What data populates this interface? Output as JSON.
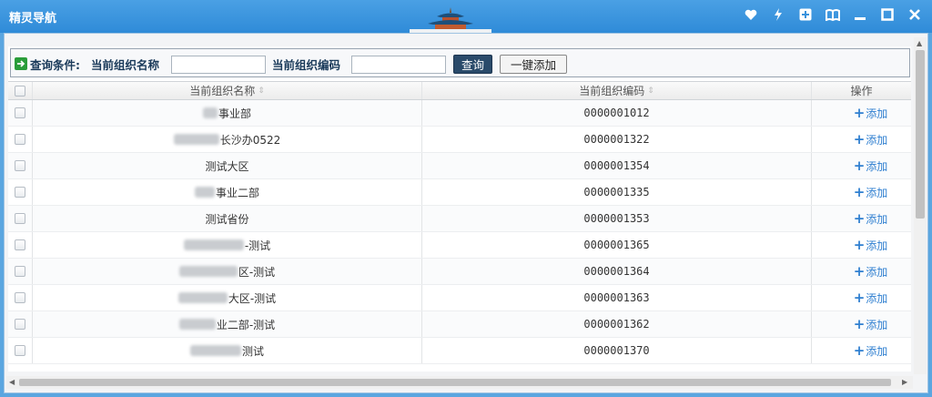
{
  "window": {
    "title": "精灵导航"
  },
  "toolbar": {
    "query_label": "查询条件:",
    "name_label": "当前组织名称",
    "name_value": "",
    "code_label": "当前组织编码",
    "code_value": "",
    "query_button": "查询",
    "add_all_button": "一键添加"
  },
  "table": {
    "headers": {
      "name": "当前组织名称",
      "code": "当前组织编码",
      "action": "操作"
    },
    "action_label": "添加",
    "rows": [
      {
        "name": "事业部",
        "code": "0000001012"
      },
      {
        "name": "长沙办0522",
        "code": "0000001322"
      },
      {
        "name": "测试大区",
        "code": "0000001354"
      },
      {
        "name": "事业二部",
        "code": "0000001335"
      },
      {
        "name": "测试省份",
        "code": "0000001353"
      },
      {
        "name": "-测试",
        "code": "0000001365"
      },
      {
        "name": "区-测试",
        "code": "0000001364"
      },
      {
        "name": "大区-测试",
        "code": "0000001363"
      },
      {
        "name": "业二部-测试",
        "code": "0000001362"
      },
      {
        "name": "测试",
        "code": "0000001370"
      }
    ]
  },
  "icons": {
    "window_controls": [
      "heart-icon",
      "bolt-icon",
      "plus-square-icon",
      "book-icon",
      "minimize-icon",
      "maximize-icon",
      "close-icon"
    ]
  },
  "colors": {
    "titlebar": "#2f8bd8",
    "link": "#2f7fd0",
    "query_button": "#2a4a6a"
  }
}
